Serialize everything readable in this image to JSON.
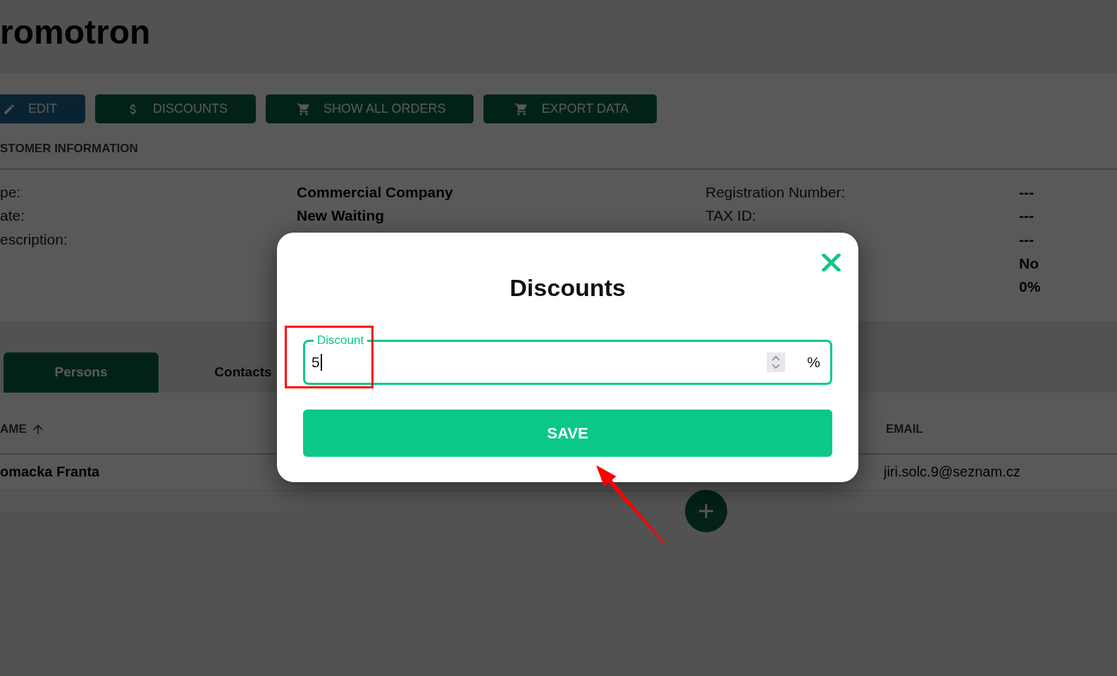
{
  "header": {
    "title": "romotron"
  },
  "toolbar": {
    "buttons": [
      {
        "label": "EDIT",
        "kind": "primary"
      },
      {
        "label": "DISCOUNTS",
        "kind": "success"
      },
      {
        "label": "SHOW ALL ORDERS",
        "kind": "success"
      },
      {
        "label": "EXPORT DATA",
        "kind": "success"
      }
    ]
  },
  "customer_information": {
    "heading": "STOMER INFORMATION",
    "left": [
      {
        "label": "pe:",
        "value": "Commercial Company"
      },
      {
        "label": "ate:",
        "value": "New Waiting"
      },
      {
        "label": "escription:"
      }
    ],
    "right": [
      {
        "label": "Registration Number:",
        "value": "---"
      },
      {
        "label": "TAX ID:",
        "value": "---"
      },
      {
        "value": "---"
      },
      {
        "value": "No"
      },
      {
        "value": "0%"
      }
    ]
  },
  "tabs": [
    {
      "label": "Persons",
      "selected": true
    },
    {
      "label": "Contacts",
      "selected": false
    }
  ],
  "table": {
    "columns": [
      {
        "label": "AME",
        "sorted": true
      },
      {
        "label": "EMAIL"
      }
    ],
    "rows": [
      {
        "cells": [
          "omacka Franta",
          "jiri.solc.9@seznam.cz"
        ]
      }
    ]
  },
  "dialog": {
    "title": "Discounts",
    "field": {
      "label": "Discount",
      "value": "5",
      "unit": "%",
      "focused": true
    },
    "save_button": "SAVE"
  }
}
